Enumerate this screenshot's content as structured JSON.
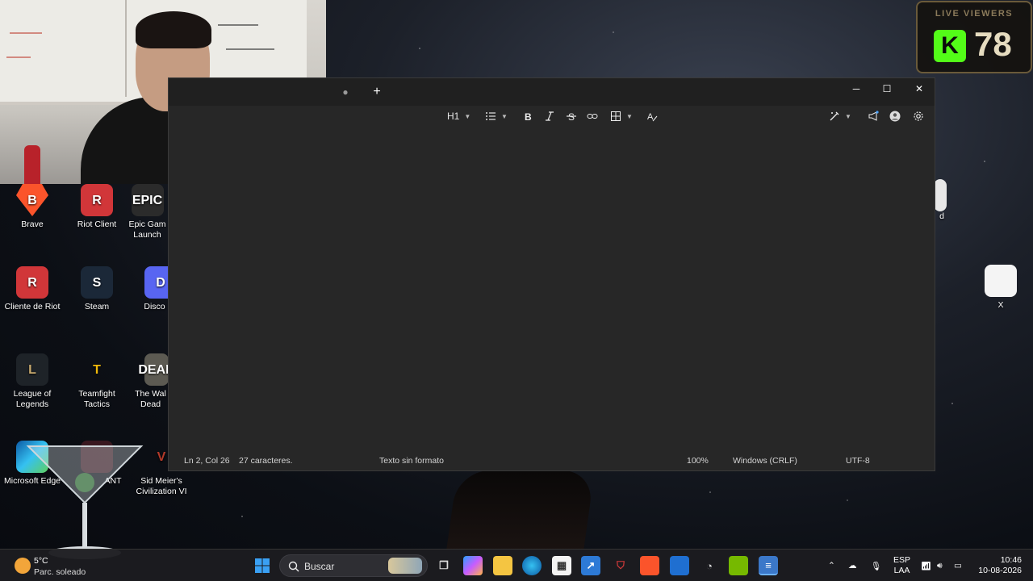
{
  "kick": {
    "title": "LIVE VIEWERS",
    "logo_letter": "K",
    "count": "78"
  },
  "desktop_icons": [
    {
      "label": "Brave",
      "glyph": "B"
    },
    {
      "label": "Riot Client",
      "glyph": "R"
    },
    {
      "label": "Epic Gam Launch",
      "glyph": "EPIC"
    },
    {
      "label": "Cliente de Riot",
      "glyph": "R"
    },
    {
      "label": "Steam",
      "glyph": "S"
    },
    {
      "label": "Disco",
      "glyph": "D"
    },
    {
      "label": "League of Legends",
      "glyph": "L"
    },
    {
      "label": "Teamfight Tactics",
      "glyph": "T"
    },
    {
      "label": "The Wal Dead",
      "glyph": "DEAD"
    },
    {
      "label": "Microsoft Edge",
      "glyph": ""
    },
    {
      "label": "ANT",
      "glyph": ""
    },
    {
      "label": "Sid Meier's Civilization VI",
      "glyph": "V"
    },
    {
      "label": "d",
      "glyph": ""
    },
    {
      "label": "X",
      "glyph": ""
    }
  ],
  "notepad": {
    "tab_indicator": "●",
    "new_tab": "+",
    "window_controls": {
      "minimize": "─",
      "maximize": "☐",
      "close": "✕"
    },
    "toolbar": {
      "heading": "H1"
    },
    "status": {
      "position": "Ln 2, Col 26",
      "chars": "27 caracteres.",
      "format": "Texto sin formato",
      "zoom": "100%",
      "eol": "Windows (CRLF)",
      "encoding": "UTF-8"
    }
  },
  "taskbar": {
    "weather_temp": "5°C",
    "weather_desc": "Parc. soleado",
    "search_label": "Buscar",
    "lang_top": "ESP",
    "lang_bottom": "LAA",
    "time": "10:46",
    "date": "10-08-2026"
  },
  "colors": {
    "kick_green": "#53fc18",
    "window_bg": "#272727",
    "taskbar_bg": "#1c1c20"
  }
}
